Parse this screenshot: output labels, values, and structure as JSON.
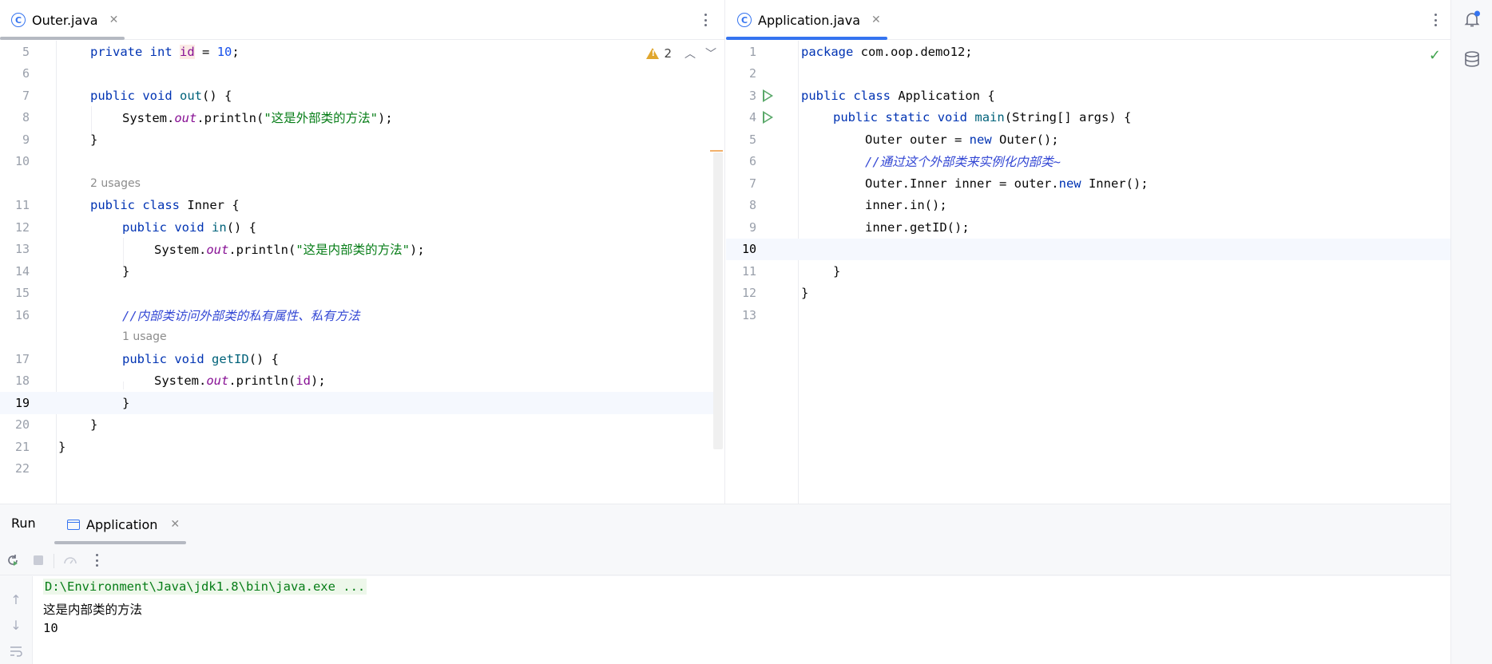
{
  "left_editor": {
    "tab": {
      "icon": "class-c-icon",
      "label": "Outer.java",
      "close": "✕"
    },
    "inspections": {
      "warning_count": "2"
    },
    "lines": [
      {
        "n": "5",
        "code": "private_int_id"
      },
      {
        "n": "6"
      },
      {
        "n": "7"
      },
      {
        "n": "8"
      },
      {
        "n": "9"
      },
      {
        "n": "10"
      },
      {
        "hint": "2 usages"
      },
      {
        "n": "11"
      },
      {
        "n": "12"
      },
      {
        "n": "13"
      },
      {
        "n": "14"
      },
      {
        "n": "15"
      },
      {
        "n": "16"
      },
      {
        "hint": "1 usage"
      },
      {
        "n": "17"
      },
      {
        "n": "18"
      },
      {
        "n": "19"
      },
      {
        "n": "20"
      },
      {
        "n": "21"
      },
      {
        "n": "22"
      }
    ],
    "code": {
      "l5": {
        "kw1": "private",
        "kw2": "int",
        "ident": "id",
        "rest": " = ",
        "num": "10",
        "end": ";"
      },
      "l7": {
        "kw1": "public",
        "kw2": "void",
        "name": "out",
        "rest": "() {"
      },
      "l8": {
        "pre": "System.",
        "field": "out",
        "mid": ".println(",
        "str": "\"这是外部类的方法\"",
        "end": ");"
      },
      "l9": "}",
      "l11": {
        "kw1": "public",
        "kw2": "class",
        "rest": " Inner {"
      },
      "l12": {
        "kw1": "public",
        "kw2": "void",
        "name": "in",
        "rest": "() {"
      },
      "l13": {
        "pre": "System.",
        "field": "out",
        "mid": ".println(",
        "str": "\"这是内部类的方法\"",
        "end": ");"
      },
      "l14": "}",
      "l16": "//内部类访问外部类的私有属性、私有方法",
      "l17": {
        "kw1": "public",
        "kw2": "void",
        "name": "getID",
        "rest": "() {"
      },
      "l18": {
        "pre": "System.",
        "field": "out",
        "mid": ".println(",
        "ident": "id",
        "end": ");"
      },
      "l19": "}",
      "l20": "}",
      "l21": "}"
    }
  },
  "right_editor": {
    "tab": {
      "icon": "class-c-icon",
      "label": "Application.java",
      "close": "✕"
    },
    "numbers": [
      "1",
      "2",
      "3",
      "4",
      "5",
      "6",
      "7",
      "8",
      "9",
      "10",
      "11",
      "12",
      "13"
    ],
    "code": {
      "l1": {
        "kw": "package",
        "rest": " com.oop.demo12;"
      },
      "l3": {
        "kw1": "public",
        "kw2": "class",
        "rest": " Application {"
      },
      "l4": {
        "kw1": "public",
        "kw2": "static",
        "kw3": "void",
        "name": "main",
        "rest": "(String[] args) {"
      },
      "l5": {
        "pre": "Outer outer = ",
        "kw": "new",
        "rest": " Outer();"
      },
      "l6": "//通过这个外部类来实例化内部类~",
      "l7": {
        "pre": "Outer.Inner inner = outer.",
        "kw": "new",
        "rest": " Inner();"
      },
      "l8": "inner.in();",
      "l9": "inner.getID();",
      "l11": "}",
      "l12": "}"
    }
  },
  "run_window": {
    "title": "Run",
    "tab": {
      "label": "Application",
      "close": "✕"
    },
    "console": [
      "D:\\Environment\\Java\\jdk1.8\\bin\\java.exe ...",
      "这是内部类的方法",
      "10"
    ],
    "side_icons": [
      "up-arrow-icon",
      "down-arrow-icon",
      "soft-wrap-icon"
    ]
  },
  "colors": {
    "keyword": "#0033b3",
    "string": "#067d17",
    "number": "#1750eb",
    "field": "#871094",
    "method": "#00627a",
    "comment": "#3347d4",
    "accent": "#3574f0",
    "run_green": "#59a869",
    "warning": "#e0a62d"
  }
}
